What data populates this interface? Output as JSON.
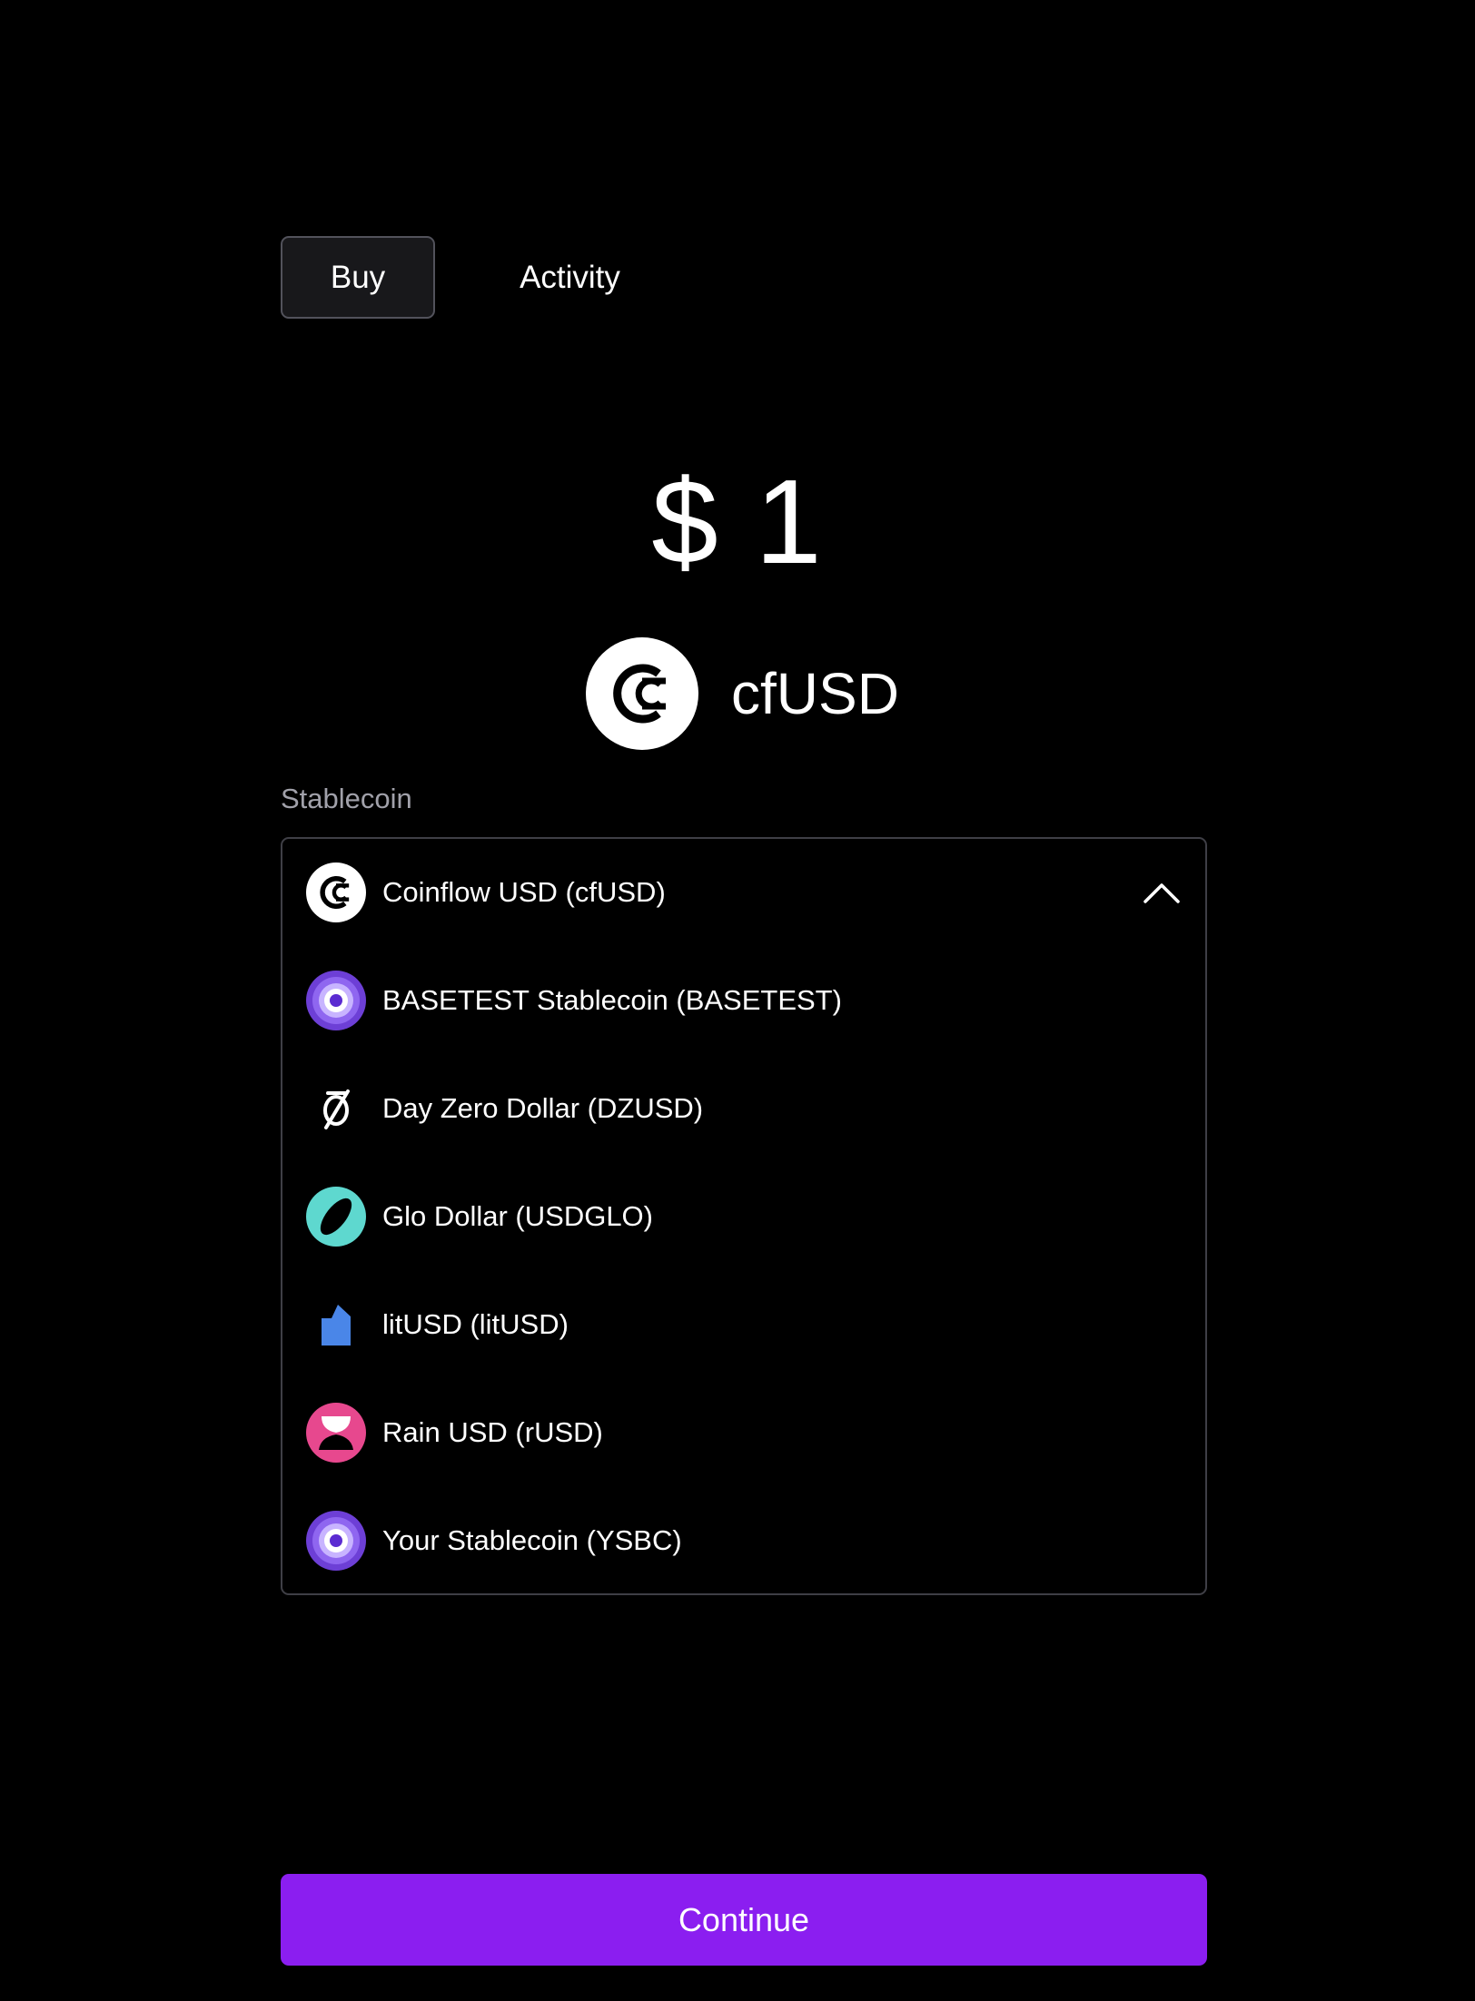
{
  "tabs": {
    "buy_label": "Buy",
    "activity_label": "Activity"
  },
  "amount": {
    "display": "$ 1"
  },
  "selected": {
    "symbol": "cfUSD",
    "icon": "coinflow-icon"
  },
  "stablecoin_field": {
    "label": "Stablecoin",
    "selected_label": "Coinflow USD (cfUSD)",
    "expanded": true
  },
  "options": [
    {
      "label": "Coinflow USD (cfUSD)",
      "icon": "coinflow-icon"
    },
    {
      "label": "BASETEST Stablecoin (BASETEST)",
      "icon": "purple-ring-icon"
    },
    {
      "label": "Day Zero Dollar (DZUSD)",
      "icon": "slashed-zero-icon"
    },
    {
      "label": "Glo Dollar (USDGLO)",
      "icon": "glo-ring-icon"
    },
    {
      "label": "litUSD (litUSD)",
      "icon": "blue-tag-icon"
    },
    {
      "label": "Rain USD (rUSD)",
      "icon": "pink-hourglass-icon"
    },
    {
      "label": "Your Stablecoin (YSBC)",
      "icon": "purple-ring-icon"
    }
  ],
  "continue_label": "Continue",
  "colors": {
    "background": "#000000",
    "accent": "#8b1ef0",
    "muted_text": "#a1a1aa",
    "border": "#3f3f46"
  }
}
